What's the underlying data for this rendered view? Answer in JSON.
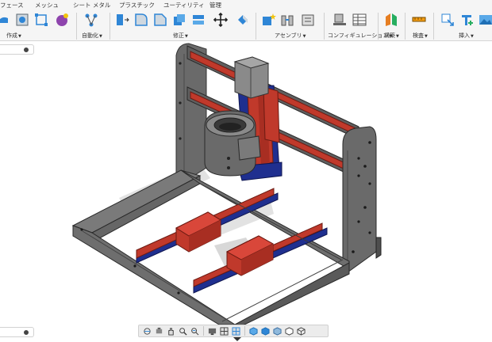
{
  "toolbar": {
    "tabs": [
      "フェース",
      "メッシュ",
      "シート メタル",
      "プラスチック",
      "ユーティリティ",
      "管理"
    ],
    "groups": {
      "create": "作成",
      "automate": "自動化",
      "modify": "修正",
      "assemble": "アセンブリ",
      "configure": "コンフィギュレーション",
      "construct": "構築",
      "inspect": "検査",
      "insert": "挿入"
    }
  },
  "colors": {
    "frame": "#5f5f5f",
    "rail_red": "#c0392b",
    "rail_blue": "#1f2f8f",
    "accent": "#2f86d6"
  }
}
